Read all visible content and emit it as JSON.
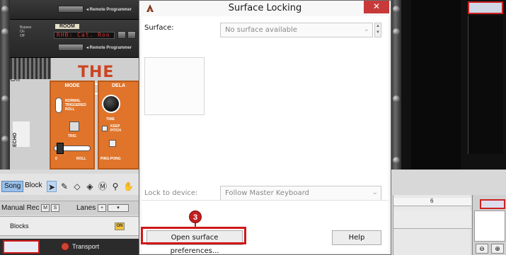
{
  "dialog": {
    "title": "Surface Locking",
    "close_glyph": "✕",
    "surface_label": "Surface:",
    "surface_value": "No surface available",
    "lock_label": "Lock to device:",
    "lock_value": "Follow Master Keyboard",
    "open_prefs_button": "Open surface preferences...",
    "help_button": "Help",
    "step_number": "3"
  },
  "rack": {
    "unit1_remote": "◂ Remote Programmer",
    "unit2_bypass": [
      "Bypass",
      "On",
      "Off"
    ],
    "unit2_room": "ROOM",
    "unit2_lcd": "RHB: Cat. Roo",
    "unit2_remote": "◂ Remote Programmer",
    "echo_bypass": [
      "Bypass",
      "On",
      "Off"
    ],
    "echo_brand_colored": "THE",
    "echo_brand_white": " ECH",
    "echo_mode_header": "MODE",
    "echo_delay_header": "DELA",
    "echo_mode_labels": [
      "NORMAL",
      "TRIGGERED",
      "ROLL"
    ],
    "echo_trig": "TRIG",
    "echo_zero": "0",
    "echo_roll": "ROLL",
    "echo_time": "TIME",
    "echo_keep_pitch": [
      "KEEP",
      "PITCH"
    ],
    "echo_ping_pong": "PING-PONG",
    "echo_side_label": "ECHO"
  },
  "sequencer": {
    "tab_song": "Song",
    "tab_block": "Block",
    "track_header_label": "Manual Rec",
    "m_btn": "M",
    "s_btn": "S",
    "lanes_label": "Lanes",
    "blocks_label": "Blocks",
    "on_label": "ON",
    "transport_label": "Transport",
    "ruler_mark": "6",
    "zoom_out": "⊖",
    "zoom_in": "⊕"
  }
}
